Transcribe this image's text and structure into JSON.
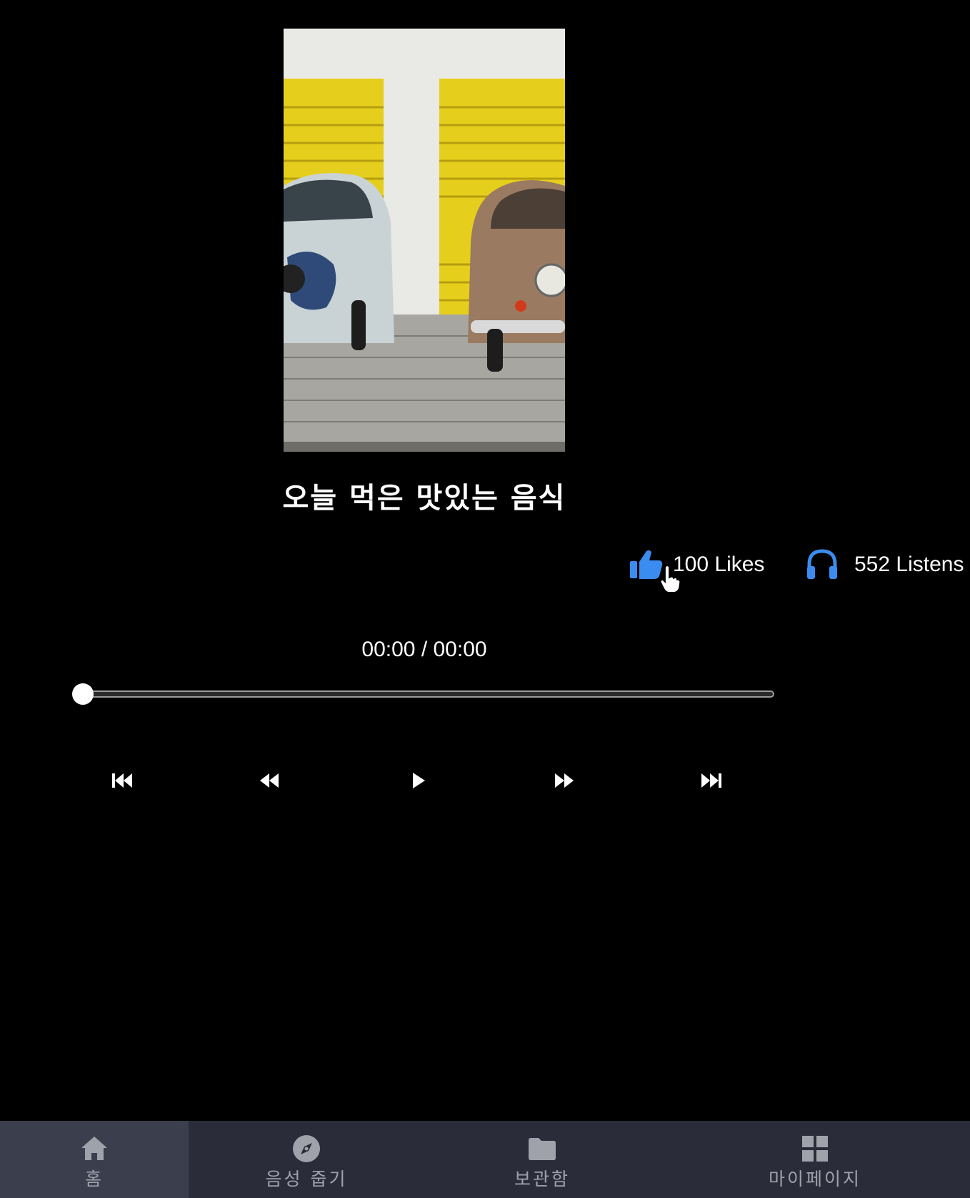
{
  "track": {
    "title": "오늘 먹은 맛있는 음식",
    "cover_description": "two vintage cars parked in front of yellow garage doors"
  },
  "stats": {
    "likes": "100 Likes",
    "listens": "552 Listens"
  },
  "player": {
    "time": "00:00 / 00:00",
    "progress": 0
  },
  "controls": {
    "skip_back": "skip-back",
    "rewind": "rewind",
    "play": "play",
    "forward": "fast-forward",
    "skip_forward": "skip-forward"
  },
  "nav": {
    "items": [
      {
        "label": "홈",
        "icon": "home-icon",
        "active": true
      },
      {
        "label": "음성 줍기",
        "icon": "compass-icon",
        "active": false
      },
      {
        "label": "보관함",
        "icon": "folder-icon",
        "active": false
      },
      {
        "label": "마이페이지",
        "icon": "grid-icon",
        "active": false
      }
    ]
  },
  "colors": {
    "background": "#000000",
    "accent": "#3b8cf0",
    "nav_background": "#2a2c3a",
    "nav_active": "#3b3e4d",
    "nav_text": "#9fa1ab"
  }
}
